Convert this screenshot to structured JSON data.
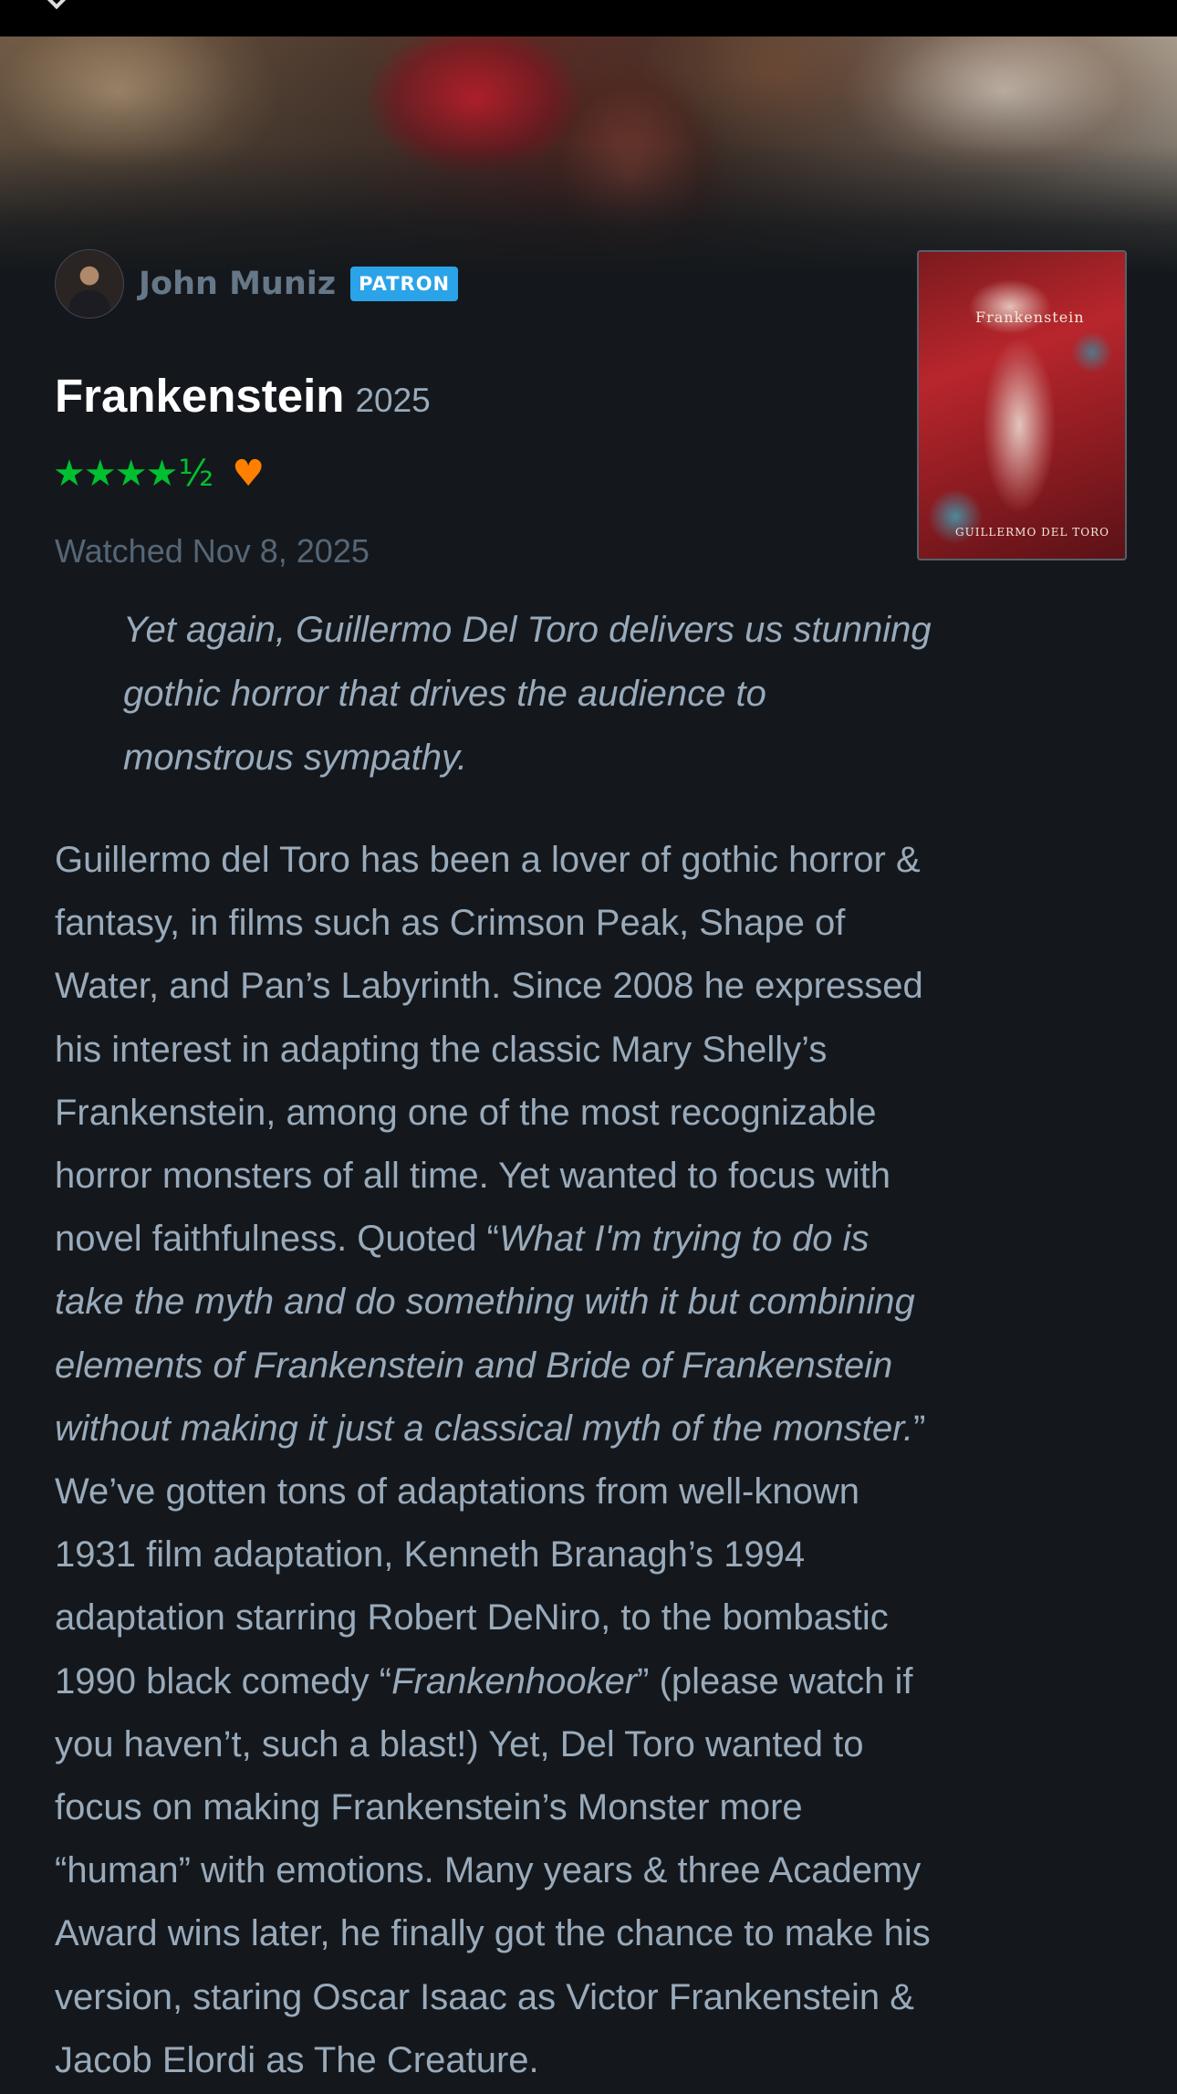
{
  "author": {
    "name": "John Muniz",
    "badge": "PATRON"
  },
  "film": {
    "title": "Frankenstein",
    "year": "2025",
    "poster_title": "Frankenstein",
    "poster_director": "GUILLERMO DEL TORO"
  },
  "rating": {
    "stars_text": "★★★★",
    "half_text": "½",
    "value": 4.5,
    "max": 5,
    "liked": true,
    "heart_icon": "♥"
  },
  "watched_date": "Watched Nov 8, 2025",
  "pull_quote": {
    "lines": [
      "Yet again, Guillermo Del Toro delivers us stunning",
      "gothic horror that drives the audience to",
      "monstrous sympathy."
    ]
  },
  "review": {
    "line1": "Guillermo del Toro has been a lover of gothic horror &",
    "line2": "fantasy, in films such as Crimson Peak, Shape of",
    "line3": "Water, and Pan’s Labyrinth. Since 2008 he expressed",
    "line4": "his interest in adapting the classic Mary Shelly’s",
    "line5": "Frankenstein, among one of the most recognizable",
    "line6": "horror monsters of all time. Yet wanted to focus with",
    "line7_plain": "novel faithfulness. Quoted “",
    "line7_italic": "What I'm trying to do is",
    "line8_italic": "take the myth and do something with it but combining",
    "line9_italic": "elements of Frankenstein and Bride of Frankenstein",
    "line10_italic": "without making it just a classical myth of the monster.",
    "line10_plain": "”",
    "line11": "We’ve gotten tons of adaptations from well-known",
    "line12": "1931 film adaptation, Kenneth Branagh’s 1994",
    "line13": "adaptation starring Robert DeNiro, to the bombastic",
    "line14_plain_a": "1990 black comedy “",
    "line14_italic": "Frankenhooker",
    "line14_plain_b": "” (please watch if",
    "line15": "you haven’t, such a blast!) Yet, Del Toro wanted to",
    "line16": "focus on making Frankenstein’s Monster more",
    "line17": "“human” with emotions. Many years & three Academy",
    "line18": "Award wins later, he finally got the chance to make his",
    "line19": "version, staring Oscar Isaac as Victor Frankenstein &",
    "line20": "Jacob Elordi as The Creature."
  },
  "colors": {
    "background": "#14181c",
    "star_green": "#00c030",
    "heart_orange": "#ff8000",
    "patron_blue": "#2ba3e8",
    "text": "#99aabb",
    "muted": "#556677"
  }
}
